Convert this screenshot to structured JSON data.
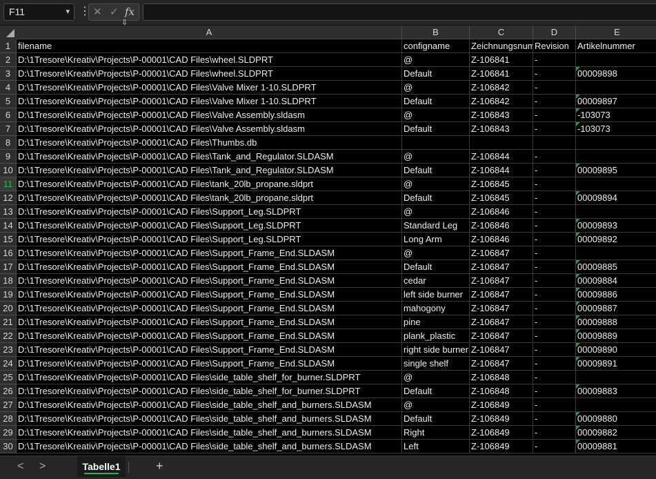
{
  "formula_bar": {
    "name_box": "F11",
    "kebab": "⋮",
    "fx": "fx",
    "formula": ""
  },
  "columns": [
    "A",
    "B",
    "C",
    "D",
    "E"
  ],
  "rows": [
    {
      "n": "1",
      "a": "filename",
      "b": "configname",
      "c": "Zeichnungsnummer",
      "d": "Revision",
      "e": "Artikelnummer",
      "flag": false
    },
    {
      "n": "2",
      "a": "D:\\1Tresore\\Kreativ\\Projects\\P-00001\\CAD Files\\wheel.SLDPRT",
      "b": "@",
      "c": "Z-106841",
      "d": "-",
      "e": "",
      "flag": false
    },
    {
      "n": "3",
      "a": "D:\\1Tresore\\Kreativ\\Projects\\P-00001\\CAD Files\\wheel.SLDPRT",
      "b": "Default",
      "c": "Z-106841",
      "d": "-",
      "e": "00009898",
      "flag": true
    },
    {
      "n": "4",
      "a": "D:\\1Tresore\\Kreativ\\Projects\\P-00001\\CAD Files\\Valve Mixer 1-10.SLDPRT",
      "b": "@",
      "c": "Z-106842",
      "d": "-",
      "e": "",
      "flag": false
    },
    {
      "n": "5",
      "a": "D:\\1Tresore\\Kreativ\\Projects\\P-00001\\CAD Files\\Valve Mixer 1-10.SLDPRT",
      "b": "Default",
      "c": "Z-106842",
      "d": "-",
      "e": "00009897",
      "flag": true
    },
    {
      "n": "6",
      "a": "D:\\1Tresore\\Kreativ\\Projects\\P-00001\\CAD Files\\Valve Assembly.sldasm",
      "b": "@",
      "c": "Z-106843",
      "d": "-",
      "e": "-103073",
      "flag": true
    },
    {
      "n": "7",
      "a": "D:\\1Tresore\\Kreativ\\Projects\\P-00001\\CAD Files\\Valve Assembly.sldasm",
      "b": "Default",
      "c": "Z-106843",
      "d": "-",
      "e": "-103073",
      "flag": true
    },
    {
      "n": "8",
      "a": "D:\\1Tresore\\Kreativ\\Projects\\P-00001\\CAD Files\\Thumbs.db",
      "b": "",
      "c": "",
      "d": "",
      "e": "",
      "flag": false
    },
    {
      "n": "9",
      "a": "D:\\1Tresore\\Kreativ\\Projects\\P-00001\\CAD Files\\Tank_and_Regulator.SLDASM",
      "b": "@",
      "c": "Z-106844",
      "d": "-",
      "e": "",
      "flag": false
    },
    {
      "n": "10",
      "a": "D:\\1Tresore\\Kreativ\\Projects\\P-00001\\CAD Files\\Tank_and_Regulator.SLDASM",
      "b": "Default",
      "c": "Z-106844",
      "d": "-",
      "e": "00009895",
      "flag": true
    },
    {
      "n": "11",
      "a": "D:\\1Tresore\\Kreativ\\Projects\\P-00001\\CAD Files\\tank_20lb_propane.sldprt",
      "b": "@",
      "c": "Z-106845",
      "d": "-",
      "e": "",
      "flag": false
    },
    {
      "n": "12",
      "a": "D:\\1Tresore\\Kreativ\\Projects\\P-00001\\CAD Files\\tank_20lb_propane.sldprt",
      "b": "Default",
      "c": "Z-106845",
      "d": "-",
      "e": "00009894",
      "flag": true
    },
    {
      "n": "13",
      "a": "D:\\1Tresore\\Kreativ\\Projects\\P-00001\\CAD Files\\Support_Leg.SLDPRT",
      "b": "@",
      "c": "Z-106846",
      "d": "-",
      "e": "",
      "flag": false
    },
    {
      "n": "14",
      "a": "D:\\1Tresore\\Kreativ\\Projects\\P-00001\\CAD Files\\Support_Leg.SLDPRT",
      "b": "Standard Leg",
      "c": "Z-106846",
      "d": "-",
      "e": "00009893",
      "flag": true
    },
    {
      "n": "15",
      "a": "D:\\1Tresore\\Kreativ\\Projects\\P-00001\\CAD Files\\Support_Leg.SLDPRT",
      "b": "Long Arm",
      "c": "Z-106846",
      "d": "-",
      "e": "00009892",
      "flag": true
    },
    {
      "n": "16",
      "a": "D:\\1Tresore\\Kreativ\\Projects\\P-00001\\CAD Files\\Support_Frame_End.SLDASM",
      "b": "@",
      "c": "Z-106847",
      "d": "-",
      "e": "",
      "flag": false
    },
    {
      "n": "17",
      "a": "D:\\1Tresore\\Kreativ\\Projects\\P-00001\\CAD Files\\Support_Frame_End.SLDASM",
      "b": "Default",
      "c": "Z-106847",
      "d": "-",
      "e": "00009885",
      "flag": true
    },
    {
      "n": "18",
      "a": "D:\\1Tresore\\Kreativ\\Projects\\P-00001\\CAD Files\\Support_Frame_End.SLDASM",
      "b": "cedar",
      "c": "Z-106847",
      "d": "-",
      "e": "00009884",
      "flag": true
    },
    {
      "n": "19",
      "a": "D:\\1Tresore\\Kreativ\\Projects\\P-00001\\CAD Files\\Support_Frame_End.SLDASM",
      "b": "left side burner",
      "c": "Z-106847",
      "d": "-",
      "e": "00009886",
      "flag": true
    },
    {
      "n": "20",
      "a": "D:\\1Tresore\\Kreativ\\Projects\\P-00001\\CAD Files\\Support_Frame_End.SLDASM",
      "b": "mahogony",
      "c": "Z-106847",
      "d": "-",
      "e": "00009887",
      "flag": true
    },
    {
      "n": "21",
      "a": "D:\\1Tresore\\Kreativ\\Projects\\P-00001\\CAD Files\\Support_Frame_End.SLDASM",
      "b": "pine",
      "c": "Z-106847",
      "d": "-",
      "e": "00009888",
      "flag": true
    },
    {
      "n": "22",
      "a": "D:\\1Tresore\\Kreativ\\Projects\\P-00001\\CAD Files\\Support_Frame_End.SLDASM",
      "b": "plank_plastic",
      "c": "Z-106847",
      "d": "-",
      "e": "00009889",
      "flag": true
    },
    {
      "n": "23",
      "a": "D:\\1Tresore\\Kreativ\\Projects\\P-00001\\CAD Files\\Support_Frame_End.SLDASM",
      "b": "right side burner",
      "c": "Z-106847",
      "d": "-",
      "e": "00009890",
      "flag": true
    },
    {
      "n": "24",
      "a": "D:\\1Tresore\\Kreativ\\Projects\\P-00001\\CAD Files\\Support_Frame_End.SLDASM",
      "b": "single shelf",
      "c": "Z-106847",
      "d": "-",
      "e": "00009891",
      "flag": true
    },
    {
      "n": "25",
      "a": "D:\\1Tresore\\Kreativ\\Projects\\P-00001\\CAD Files\\side_table_shelf_for_burner.SLDPRT",
      "b": "@",
      "c": "Z-106848",
      "d": "-",
      "e": "",
      "flag": false
    },
    {
      "n": "26",
      "a": "D:\\1Tresore\\Kreativ\\Projects\\P-00001\\CAD Files\\side_table_shelf_for_burner.SLDPRT",
      "b": "Default",
      "c": "Z-106848",
      "d": "-",
      "e": "00009883",
      "flag": true
    },
    {
      "n": "27",
      "a": "D:\\1Tresore\\Kreativ\\Projects\\P-00001\\CAD Files\\side_table_shelf_and_burners.SLDASM",
      "b": "@",
      "c": "Z-106849",
      "d": "-",
      "e": "",
      "flag": false
    },
    {
      "n": "28",
      "a": "D:\\1Tresore\\Kreativ\\Projects\\P-00001\\CAD Files\\side_table_shelf_and_burners.SLDASM",
      "b": "Default",
      "c": "Z-106849",
      "d": "-",
      "e": "00009880",
      "flag": true
    },
    {
      "n": "29",
      "a": "D:\\1Tresore\\Kreativ\\Projects\\P-00001\\CAD Files\\side_table_shelf_and_burners.SLDASM",
      "b": "Right",
      "c": "Z-106849",
      "d": "-",
      "e": "00009882",
      "flag": true
    },
    {
      "n": "30",
      "a": "D:\\1Tresore\\Kreativ\\Projects\\P-00001\\CAD Files\\side_table_shelf_and_burners.SLDASM",
      "b": "Left",
      "c": "Z-106849",
      "d": "-",
      "e": "00009881",
      "flag": true
    }
  ],
  "sheet_tabs": {
    "active": "Tabelle1",
    "prev": "<",
    "next": ">",
    "add": "+"
  },
  "colors": {
    "accent_green": "#2fb24f",
    "grid_background": "#000000",
    "header_background": "#2e2e2e"
  }
}
